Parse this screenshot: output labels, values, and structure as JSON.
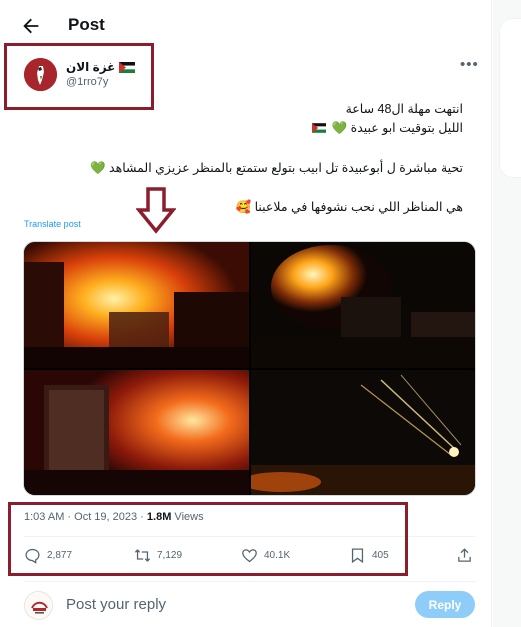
{
  "header": {
    "title": "Post"
  },
  "author": {
    "display_name": "غزة الان",
    "handle": "@1rro7y"
  },
  "post": {
    "line1": "انتهت مهلة ال48 ساعة",
    "line2_text": "الليل بتوقيت ابو عبيدة",
    "line3_text": "تحية مباشرة ل أبوعبيدة  تل ابيب بتولع ستمتع بالمنظر عزيزي المشاهد",
    "line4_text": "هي  المناظر اللي نحب نشوفها في ملاعبنا",
    "translate_label": "Translate post"
  },
  "meta": {
    "time": "1:03 AM · Oct 19, 2023 · ",
    "views_count": "1.8M",
    "views_label": " Views"
  },
  "actions": {
    "replies": "2,877",
    "reposts": "7,129",
    "likes": "40.1K",
    "bookmarks": "405"
  },
  "reply": {
    "placeholder": "Post your reply",
    "button_label": "Reply"
  },
  "colors": {
    "accent": "#1d9bf0",
    "annotation": "#8b1e2d",
    "reply_button": "#8ecdf8"
  }
}
